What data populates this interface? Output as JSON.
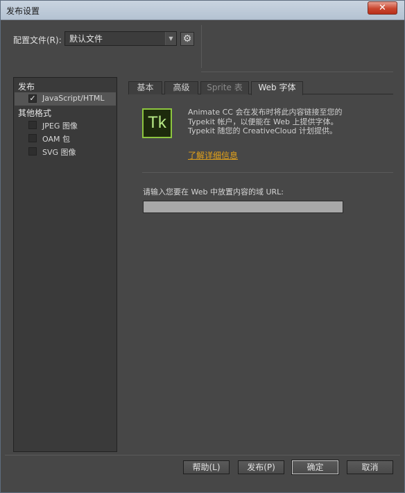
{
  "window": {
    "title": "发布设置",
    "close_glyph": "✕"
  },
  "profile": {
    "label": "配置文件(R):",
    "value": "默认文件",
    "arrow": "▼",
    "gear_glyph": "⚙"
  },
  "left_panel": {
    "publish_heading": "发布",
    "publish_items": [
      {
        "label": "JavaScript/HTML",
        "checked": true,
        "selected": true
      }
    ],
    "other_heading": "其他格式",
    "other_items": [
      {
        "label": "JPEG 图像",
        "checked": false
      },
      {
        "label": "OAM 包",
        "checked": false
      },
      {
        "label": "SVG 图像",
        "checked": false
      }
    ],
    "check_glyph": "✓"
  },
  "tabs": [
    {
      "label": "基本",
      "state": "normal"
    },
    {
      "label": "高级",
      "state": "normal"
    },
    {
      "label": "Sprite 表",
      "state": "disabled"
    },
    {
      "label": "Web 字体",
      "state": "active"
    }
  ],
  "webfont": {
    "logo_text": "Tk",
    "description": "Animate CC 会在发布时将此内容链接至您的 Typekit 帐户，以便能在 Web 上提供字体。Typekit 随您的 CreativeCloud 计划提供。",
    "learn_more": "了解详细信息",
    "url_label": "请输入您要在 Web 中放置内容的域 URL:",
    "url_value": ""
  },
  "buttons": {
    "help": "帮助(L)",
    "publish": "发布(P)",
    "ok": "确定",
    "cancel": "取消"
  },
  "colors": {
    "logo_border": "#8dc63f",
    "link": "#e3a21a",
    "close": "#c9462f"
  }
}
